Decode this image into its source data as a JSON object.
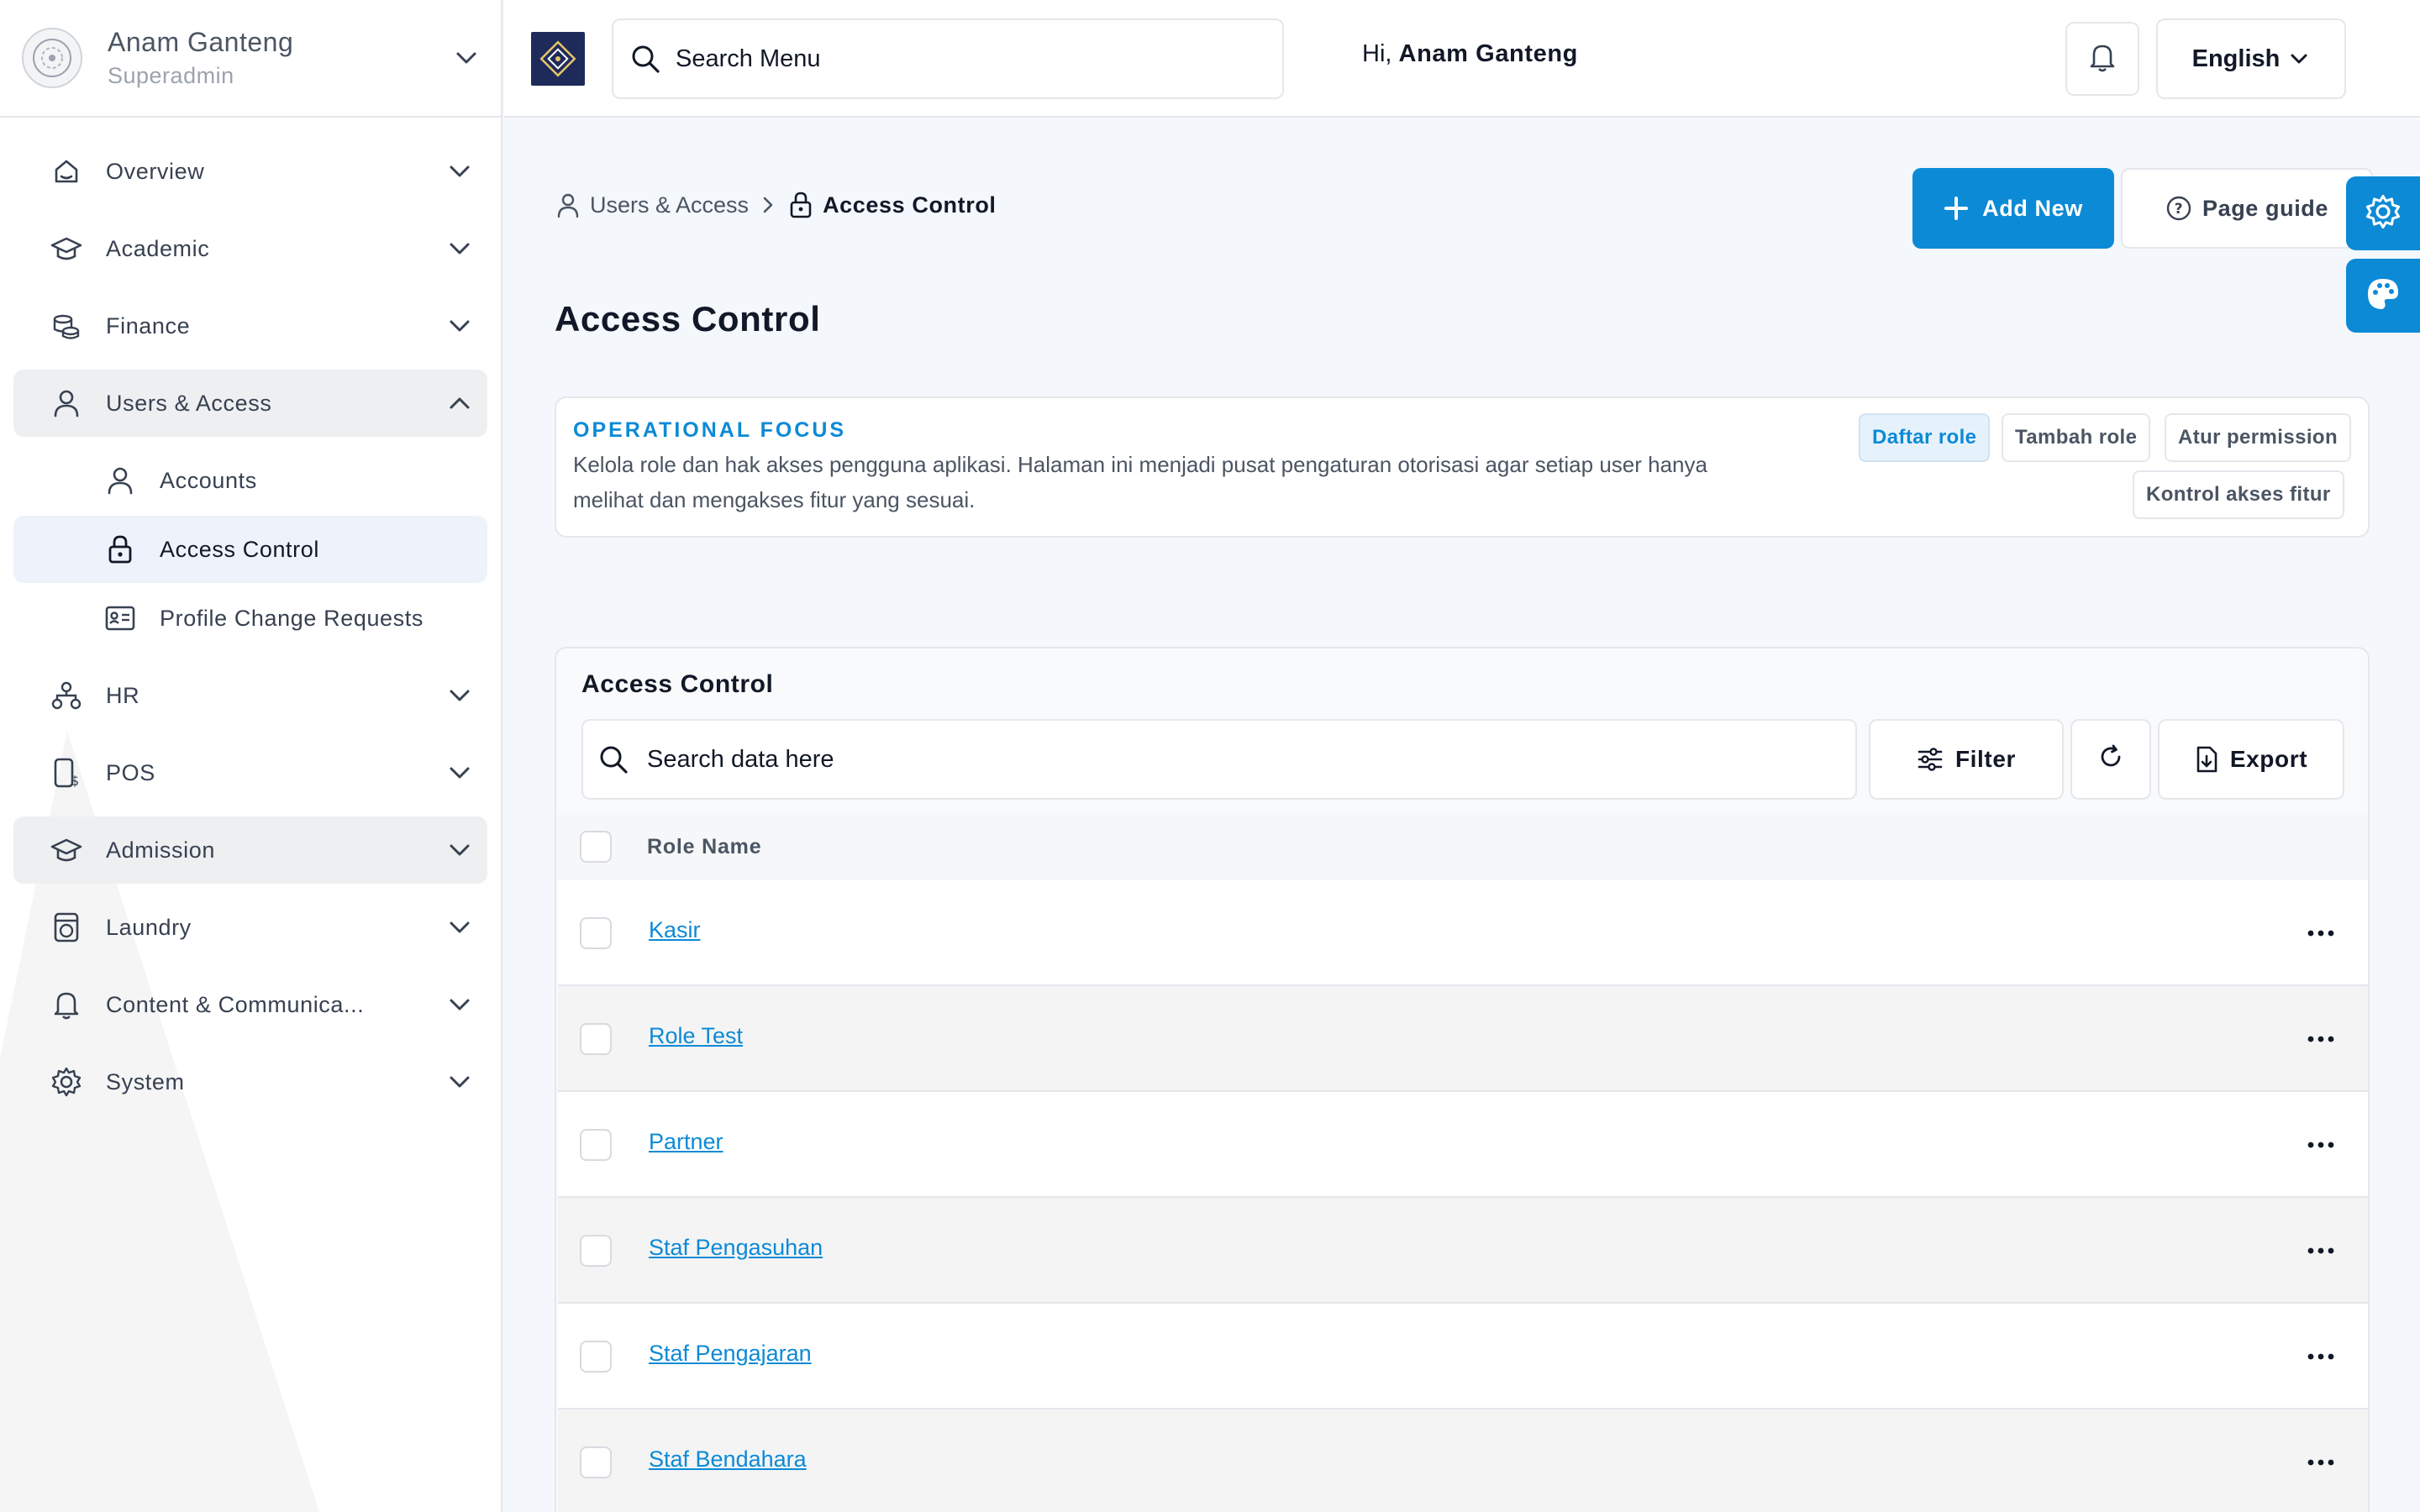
{
  "user": {
    "name": "Anam Ganteng",
    "role": "Superadmin"
  },
  "sidebar": {
    "items": [
      {
        "label": "Overview",
        "icon": "home-icon"
      },
      {
        "label": "Academic",
        "icon": "graduation-cap-icon"
      },
      {
        "label": "Finance",
        "icon": "coins-icon"
      },
      {
        "label": "Users & Access",
        "icon": "user-icon",
        "expanded": true
      },
      {
        "label": "HR",
        "icon": "org-chart-icon"
      },
      {
        "label": "POS",
        "icon": "pos-device-icon"
      },
      {
        "label": "Admission",
        "icon": "graduation-cap-icon"
      },
      {
        "label": "Laundry",
        "icon": "washing-machine-icon"
      },
      {
        "label": "Content & Communica...",
        "icon": "bell-icon"
      },
      {
        "label": "System",
        "icon": "gear-icon"
      }
    ],
    "sub_items": [
      {
        "label": "Accounts",
        "icon": "user-icon"
      },
      {
        "label": "Access Control",
        "icon": "lock-icon",
        "current": true
      },
      {
        "label": "Profile Change Requests",
        "icon": "id-card-icon"
      }
    ]
  },
  "topbar": {
    "search_placeholder": "Search Menu",
    "greeting_prefix": "Hi, ",
    "greeting_name": "Anam Ganteng",
    "language": "English"
  },
  "breadcrumb": {
    "parent": "Users & Access",
    "current": "Access Control"
  },
  "actions": {
    "add_new": "Add New",
    "page_guide": "Page guide"
  },
  "page_title": "Access Control",
  "focus": {
    "title": "OPERATIONAL FOCUS",
    "description": "Kelola role dan hak akses pengguna aplikasi. Halaman ini menjadi pusat pengaturan otorisasi agar setiap user hanya melihat dan mengakses fitur yang sesuai.",
    "chips": [
      "Daftar role",
      "Tambah role",
      "Atur permission",
      "Kontrol akses fitur"
    ]
  },
  "table": {
    "title": "Access Control",
    "search_placeholder": "Search data here",
    "filter_label": "Filter",
    "export_label": "Export",
    "column_role_name": "Role Name",
    "rows": [
      "Kasir",
      "Role Test",
      "Partner",
      "Staf Pengasuhan",
      "Staf Pengajaran",
      "Staf Bendahara"
    ]
  },
  "colors": {
    "accent": "#0c8ad6",
    "text": "#111827",
    "muted": "#4b5563",
    "active_nav": "#eeeff1",
    "current_nav": "#eef2fb"
  }
}
